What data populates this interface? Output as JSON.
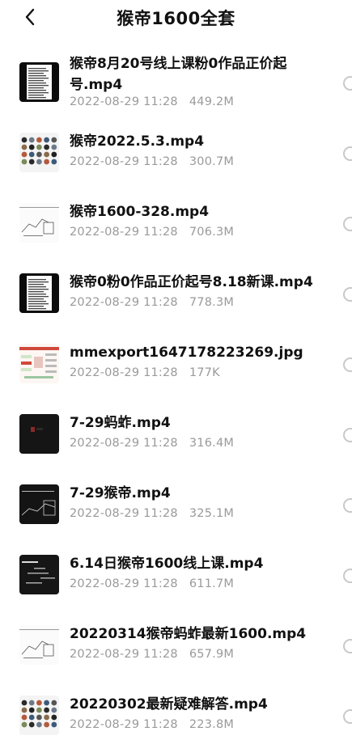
{
  "header": {
    "title": "猴帝1600全套",
    "back_icon": "chevron-left-icon"
  },
  "files": [
    {
      "name": "猴帝8月20号线上课粉0作品正价起号.mp4",
      "date": "2022-08-29 11:28",
      "size": "449.2M",
      "thumb": "text-doc"
    },
    {
      "name": "猴帝2022.5.3.mp4",
      "date": "2022-08-29 11:28",
      "size": "300.7M",
      "thumb": "avatar-grid"
    },
    {
      "name": "猴帝1600-328.mp4",
      "date": "2022-08-29 11:28",
      "size": "706.3M",
      "thumb": "sketch-light"
    },
    {
      "name": "猴帝0粉0作品正价起号8.18新课.mp4",
      "date": "2022-08-29 11:28",
      "size": "778.3M",
      "thumb": "text-doc"
    },
    {
      "name": "mmexport1647178223269.jpg",
      "date": "2022-08-29 11:28",
      "size": "177K",
      "thumb": "mindmap"
    },
    {
      "name": "7-29蚂蚱.mp4",
      "date": "2022-08-29 11:28",
      "size": "316.4M",
      "thumb": "dark-video"
    },
    {
      "name": "7-29猴帝.mp4",
      "date": "2022-08-29 11:28",
      "size": "325.1M",
      "thumb": "dark-sketch"
    },
    {
      "name": "6.14日猴帝1600线上课.mp4",
      "date": "2022-08-29 11:28",
      "size": "611.7M",
      "thumb": "dark-slide"
    },
    {
      "name": "20220314猴帝蚂蚱最新1600.mp4",
      "date": "2022-08-29 11:28",
      "size": "657.9M",
      "thumb": "sketch-light"
    },
    {
      "name": "20220302最新疑难解答.mp4",
      "date": "2022-08-29 11:28",
      "size": "223.8M",
      "thumb": "avatar-grid"
    }
  ]
}
